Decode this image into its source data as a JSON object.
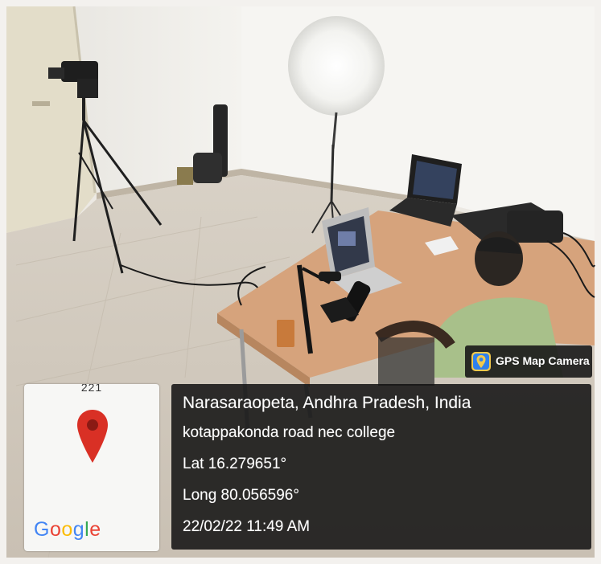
{
  "map_thumbnail": {
    "road_label": "221",
    "pin_color": "#d93025",
    "logo_letters": [
      {
        "char": "G",
        "color": "#4285f4"
      },
      {
        "char": "o",
        "color": "#ea4335"
      },
      {
        "char": "o",
        "color": "#fbbc05"
      },
      {
        "char": "g",
        "color": "#4285f4"
      },
      {
        "char": "l",
        "color": "#34a853"
      },
      {
        "char": "e",
        "color": "#ea4335"
      }
    ]
  },
  "location": {
    "place": "Narasaraopeta, Andhra Pradesh, India",
    "address": "kotappakonda road nec college",
    "latitude": "Lat 16.279651°",
    "longitude": "Long 80.056596°",
    "timestamp": "22/02/22 11:49 AM"
  },
  "app": {
    "name": "GPS Map Camera",
    "icon": "map-pin-app-icon"
  }
}
